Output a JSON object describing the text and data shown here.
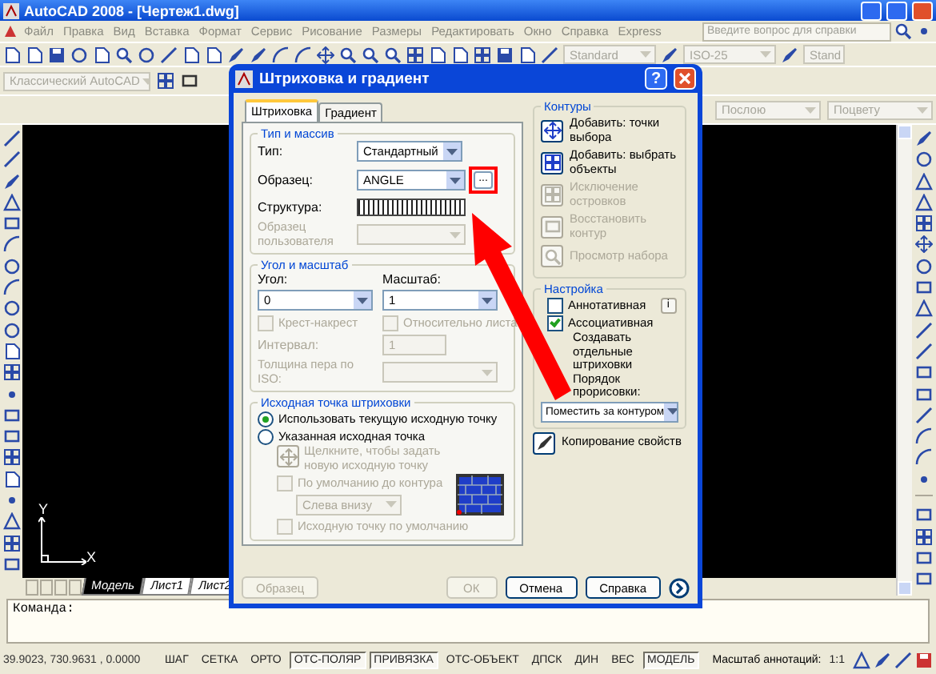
{
  "window": {
    "title": "AutoCAD 2008 - [Чертеж1.dwg]"
  },
  "menu": [
    "Файл",
    "Правка",
    "Вид",
    "Вставка",
    "Формат",
    "Сервис",
    "Рисование",
    "Размеры",
    "Редактировать",
    "Окно",
    "Справка",
    "Express"
  ],
  "help_search": {
    "placeholder": "Введите вопрос для справки"
  },
  "toolbar_combos": [
    "Standard",
    "ISO-25",
    "Stand"
  ],
  "workspace": "Классический AutoCAD",
  "properties_combos": [
    "Послою",
    "Поцвету"
  ],
  "canvas": {
    "ucs_labels": [
      "Y",
      "X"
    ]
  },
  "layout_tabs": [
    {
      "label": "Модель",
      "selected": true
    },
    {
      "label": "Лист1",
      "selected": false
    },
    {
      "label": "Лист2",
      "selected": false
    }
  ],
  "command_line": {
    "prompt": "Команда:"
  },
  "status_bar": {
    "coordinates": "39.9023,  730.9631 , 0.0000",
    "toggles": [
      {
        "label": "ШАГ",
        "on": false
      },
      {
        "label": "СЕТКА",
        "on": false
      },
      {
        "label": "ОРТО",
        "on": false
      },
      {
        "label": "ОТС-ПОЛЯР",
        "on": true
      },
      {
        "label": "ПРИВЯЗКА",
        "on": true
      },
      {
        "label": "ОТС-ОБЪЕКТ",
        "on": false
      },
      {
        "label": "ДПСК",
        "on": false
      },
      {
        "label": "ДИН",
        "on": false
      },
      {
        "label": "ВЕС",
        "on": false
      },
      {
        "label": "МОДЕЛЬ",
        "on": true
      }
    ],
    "annotation_scale_label": "Масштаб аннотаций:",
    "annotation_scale": "1:1"
  },
  "dialog": {
    "title": "Штриховка и градиент",
    "help_button": "?",
    "tabs": [
      {
        "label": "Штриховка",
        "selected": true
      },
      {
        "label": "Градиент",
        "selected": false
      }
    ],
    "type_group": {
      "title": "Тип и массив",
      "type": {
        "label": "Тип:",
        "value": "Стандартный"
      },
      "pattern": {
        "label": "Образец:",
        "value": "ANGLE"
      },
      "browse_button": "...",
      "swatch_label": "Структура:",
      "custom": {
        "label": "Образец пользователя",
        "disabled": true
      }
    },
    "angle_group": {
      "title": "Угол и масштаб",
      "angle": {
        "label": "Угол:",
        "value": "0"
      },
      "scale": {
        "label": "Масштаб:",
        "value": "1"
      },
      "checkboxes": [
        {
          "label": "Крест-накрест",
          "checked": false,
          "disabled": true
        },
        {
          "label": "Относительно листа",
          "checked": false,
          "disabled": true
        }
      ],
      "spacing": {
        "label": "Интервал:",
        "value": "1",
        "disabled": true
      },
      "pen": {
        "label": "Толщина пера по ISO:",
        "disabled": true
      }
    },
    "origin_group": {
      "title": "Исходная точка штриховки",
      "radios": [
        {
          "label": "Использовать текущую исходную точку",
          "selected": true
        },
        {
          "label": "Указанная исходная точка",
          "selected": false
        }
      ],
      "pick": {
        "label": "Щелкните, чтобы задать новую исходную точку",
        "disabled": true
      },
      "checkboxes": [
        {
          "label": "По умолчанию до контура",
          "checked": false,
          "disabled": true
        },
        {
          "label": "Исходную точку по умолчанию",
          "checked": false,
          "disabled": true
        }
      ],
      "position": {
        "value": "Слева внизу",
        "disabled": true
      }
    },
    "boundaries_group": {
      "title": "Контуры",
      "buttons": [
        {
          "label": "Добавить: точки выбора",
          "disabled": false
        },
        {
          "label": "Добавить: выбрать объекты",
          "disabled": false
        },
        {
          "label": "Исключение островков",
          "disabled": true
        },
        {
          "label": "Восстановить контур",
          "disabled": true
        },
        {
          "label": "Просмотр набора",
          "disabled": true
        }
      ]
    },
    "options_group": {
      "title": "Настройка",
      "checkboxes": [
        {
          "label": "Аннотативная",
          "checked": false
        },
        {
          "label": "Ассоциативная",
          "checked": true
        }
      ],
      "info_icon": "i",
      "separate_label": "Создавать отдельные штриховки",
      "draw_order_label": "Порядок прорисовки:",
      "draw_order_value": "Поместить за контуром"
    },
    "inherit_button": "Копирование свойств",
    "buttons": [
      {
        "label": "Образец",
        "disabled": true
      },
      {
        "label": "ОК",
        "disabled": true
      },
      {
        "label": "Отмена",
        "disabled": false
      },
      {
        "label": "Справка",
        "disabled": false
      }
    ]
  }
}
